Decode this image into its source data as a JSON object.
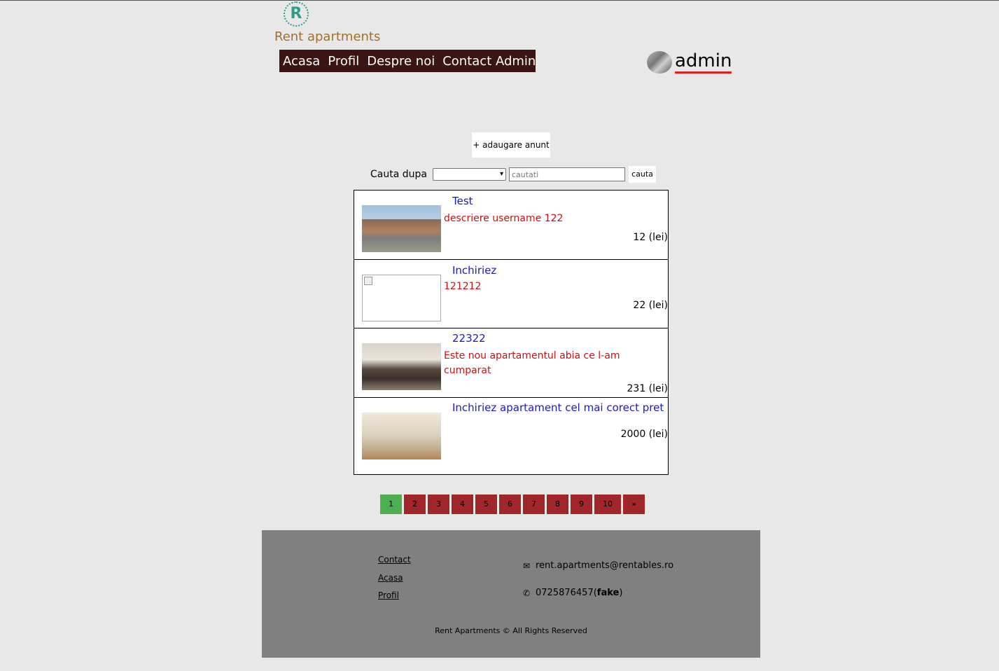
{
  "logo": {
    "mark": "R",
    "text": "Rent apartments"
  },
  "nav": [
    {
      "label": "Acasa"
    },
    {
      "label": "Profil"
    },
    {
      "label": "Despre noi"
    },
    {
      "label": "Contact Admin"
    }
  ],
  "user": {
    "name": "admin"
  },
  "add_button": "+ adaugare anunt",
  "search": {
    "label": "Cauta dupa",
    "select_value": "",
    "placeholder": "cautati",
    "button": "cauta"
  },
  "listings": [
    {
      "title": "Test",
      "description": "descriere username 122",
      "price": "12 (lei)"
    },
    {
      "title": "Inchiriez",
      "description": "121212",
      "price": "22 (lei)"
    },
    {
      "title": "22322",
      "description": "Este nou apartamentul abia ce l-am cumparat",
      "price": "231 (lei)"
    },
    {
      "title": "Inchiriez apartament cel mai corect pret",
      "description": "",
      "price": "2000 (lei)"
    }
  ],
  "pagination": {
    "current": "1",
    "pages": [
      "1",
      "2",
      "3",
      "4",
      "5",
      "6",
      "7",
      "8",
      "9",
      "10"
    ],
    "next": "»"
  },
  "footer": {
    "links": [
      "Contact",
      "Acasa",
      "Profil"
    ],
    "email": "rent.apartments@rentables.ro",
    "phone": "0725876457",
    "phone_note": "fake",
    "copyright": "Rent Apartments © All Rights Reserved"
  },
  "colors": {
    "nav_bg": "#3b1414",
    "title_link": "#1a1acc",
    "description": "#d01010",
    "page_active": "#4caf50",
    "page": "#a0262a",
    "footer_bg": "#808080"
  }
}
